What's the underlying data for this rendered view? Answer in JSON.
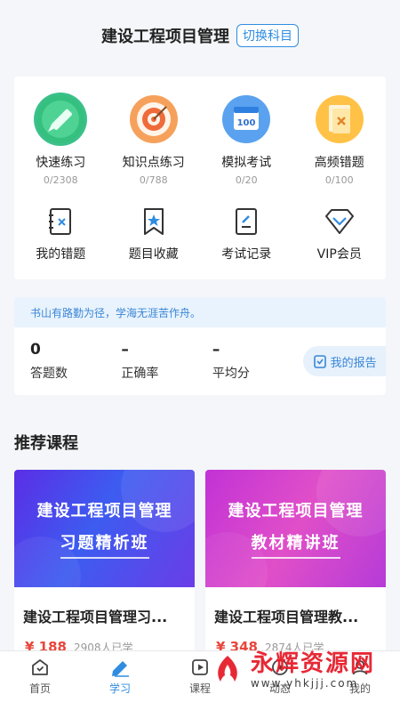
{
  "header": {
    "title": "建设工程项目管理",
    "switch_label": "切换科目"
  },
  "tools": [
    {
      "label": "快速练习",
      "count": "0/2308"
    },
    {
      "label": "知识点练习",
      "count": "0/788"
    },
    {
      "label": "模拟考试",
      "count": "0/20"
    },
    {
      "label": "高频错题",
      "count": "0/100"
    }
  ],
  "mock_exam_icon_text": "100",
  "quick_links": [
    {
      "label": "我的错题"
    },
    {
      "label": "题目收藏"
    },
    {
      "label": "考试记录"
    },
    {
      "label": "VIP会员"
    }
  ],
  "stats": {
    "quote": "书山有路勤为径，学海无涯苦作舟。",
    "items": [
      {
        "value": "0",
        "label": "答题数"
      },
      {
        "value": "–",
        "label": "正确率"
      },
      {
        "value": "–",
        "label": "平均分"
      }
    ],
    "report_label": "我的报告"
  },
  "recommended": {
    "title": "推荐课程",
    "courses": [
      {
        "banner_line1": "建设工程项目管理",
        "banner_line2": "习题精析班",
        "name": "建设工程项目管理习...",
        "price": "¥ 188",
        "learners": "2908人已学"
      },
      {
        "banner_line1": "建设工程项目管理",
        "banner_line2": "教材精讲班",
        "name": "建设工程项目管理教...",
        "price": "¥ 348",
        "learners": "2874人已学"
      }
    ]
  },
  "tabbar": [
    {
      "label": "首页"
    },
    {
      "label": "学习"
    },
    {
      "label": "课程"
    },
    {
      "label": "动态"
    },
    {
      "label": "我的"
    }
  ],
  "watermark": {
    "title": "永辉资源网",
    "url": "www.yhkjjj.com"
  },
  "colors": {
    "accent": "#2f8ce0",
    "price": "#e8463a",
    "banner_blue": "#4a3fe0",
    "banner_pink": "#d63cc8"
  }
}
